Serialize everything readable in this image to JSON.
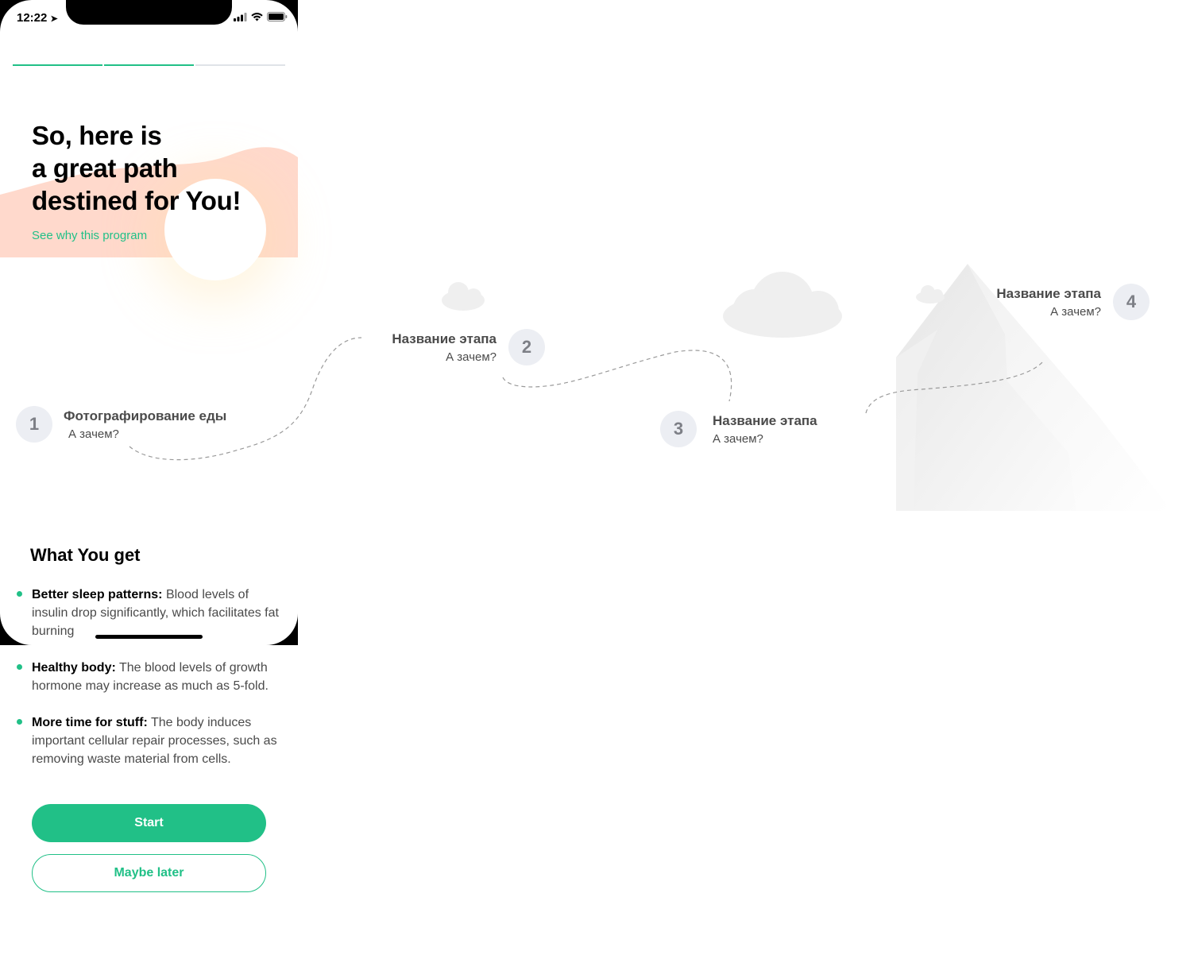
{
  "status_bar": {
    "time": "12:22"
  },
  "progress": {
    "total_segments": 3,
    "completed_segments": 2,
    "active_color": "#21c087",
    "inactive_color": "#dfe3e8"
  },
  "hero": {
    "title_lines": [
      "So, here is",
      "a great path",
      "destined for You!"
    ],
    "link": "See why this program"
  },
  "path": {
    "steps": [
      {
        "number": "1",
        "title": "Фотографирование еды",
        "subtitle": "А зачем?"
      },
      {
        "number": "2",
        "title": "Название этапа",
        "subtitle": "А зачем?"
      },
      {
        "number": "3",
        "title": "Название этапа",
        "subtitle": "А зачем?"
      },
      {
        "number": "4",
        "title": "Название этапа",
        "subtitle": "А зачем?"
      }
    ]
  },
  "benefits": {
    "title": "What You get",
    "items": [
      {
        "label": "Better sleep patterns:",
        "text": "Blood levels of insulin drop significantly, which facilitates fat burning"
      },
      {
        "label": "Healthy body:",
        "text": "The blood levels of growth hormone may increase as much as 5-fold."
      },
      {
        "label": "More time for stuff:",
        "text": "The body induces important cellular repair processes, such as removing waste material from cells."
      }
    ]
  },
  "actions": {
    "start": "Start",
    "later": "Maybe later"
  },
  "colors": {
    "accent": "#21c087",
    "blob": "#ffd9cc",
    "step_circle": "#eceef3"
  }
}
